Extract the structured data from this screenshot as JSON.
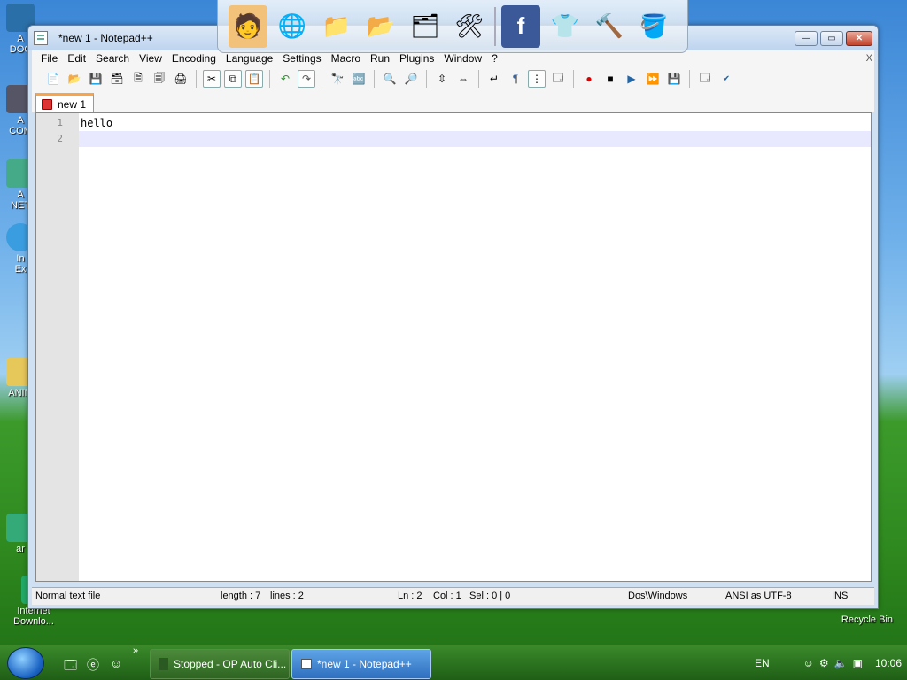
{
  "desktop": {
    "left_labels": [
      "A\nDOC",
      "A\nCOM",
      "A\nNET",
      "In\nEx",
      "ANIM",
      "ar",
      "Internet\nDownlo..."
    ],
    "recycle_bin": "Recycle Bin"
  },
  "dock": {
    "items": [
      "naruto-avatar-icon",
      "globe-icon",
      "folder-docs-icon",
      "folder-music-icon",
      "folder-pictures-icon",
      "tools-icon",
      "facebook-icon",
      "tshirt-icon",
      "hammer-icon",
      "bucket-icon"
    ]
  },
  "window": {
    "title": "*new  1 - Notepad++",
    "controls": {
      "minimize": "—",
      "restore": "▭",
      "close": "✕"
    }
  },
  "menu": [
    "File",
    "Edit",
    "Search",
    "View",
    "Encoding",
    "Language",
    "Settings",
    "Macro",
    "Run",
    "Plugins",
    "Window",
    "?"
  ],
  "menu_overflow": "X",
  "tab": {
    "label": "new  1"
  },
  "editor": {
    "line_numbers": [
      "1",
      "2"
    ],
    "lines": [
      "hello",
      ""
    ],
    "current_line": 2
  },
  "status": {
    "file_type": "Normal text file",
    "length": "length : 7",
    "lines": "lines : 2",
    "ln": "Ln : 2",
    "col": "Col : 1",
    "sel": "Sel : 0 | 0",
    "eol": "Dos\\Windows",
    "encoding": "ANSI as UTF-8",
    "mode": "INS"
  },
  "taskbar": {
    "quicklaunch_chevron": "»",
    "tasks": [
      {
        "label": "Stopped - OP Auto Cli...",
        "active": false
      },
      {
        "label": "*new  1 - Notepad++",
        "active": true
      }
    ],
    "language": "EN",
    "clock": "10:06"
  }
}
